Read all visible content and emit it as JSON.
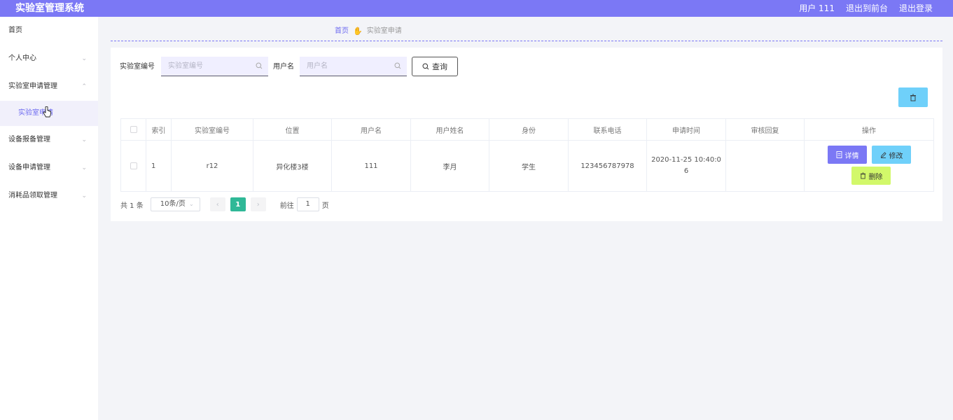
{
  "app": {
    "title": "实验室管理系统",
    "user_label": "用户 111",
    "back_to_front": "退出到前台",
    "logout": "退出登录",
    "colors": {
      "header": "#7b78f5",
      "accent": "#6d6af0",
      "page_active": "#2fb897"
    }
  },
  "sidebar": {
    "items": [
      {
        "label": "首页",
        "chevron": ""
      },
      {
        "label": "个人中心",
        "chevron": "⌄"
      },
      {
        "label": "实验室申请管理",
        "chevron": "⌃"
      },
      {
        "label": "实验室申请"
      },
      {
        "label": "设备报备管理",
        "chevron": "⌄"
      },
      {
        "label": "设备申请管理",
        "chevron": "⌄"
      },
      {
        "label": "消耗品领取管理",
        "chevron": "⌄"
      }
    ]
  },
  "breadcrumb": {
    "home": "首页",
    "current": "实验室申请"
  },
  "search": {
    "lab_no_label": "实验室编号",
    "lab_no_placeholder": "实验室编号",
    "username_label": "用户名",
    "username_placeholder": "用户名",
    "query_button": "查询"
  },
  "table": {
    "headers": [
      "",
      "索引",
      "实验室编号",
      "位置",
      "用户名",
      "用户姓名",
      "身份",
      "联系电话",
      "申请时间",
      "审核回复",
      "操作"
    ],
    "rows": [
      {
        "index": "1",
        "lab_no": "r12",
        "location": "异化楼3楼",
        "username": "111",
        "name": "李月",
        "identity": "学生",
        "phone": "123456787978",
        "time_line1": "2020-11-25 10:40:0",
        "time_line2": "6",
        "reply": ""
      }
    ],
    "actions": {
      "detail": "详情",
      "edit": "修改",
      "delete": "删除"
    }
  },
  "pager": {
    "total": "共 1 条",
    "page_size": "10条/页",
    "current_page": "1",
    "goto_label": "前往",
    "goto_value": "1",
    "page_suffix": "页"
  }
}
